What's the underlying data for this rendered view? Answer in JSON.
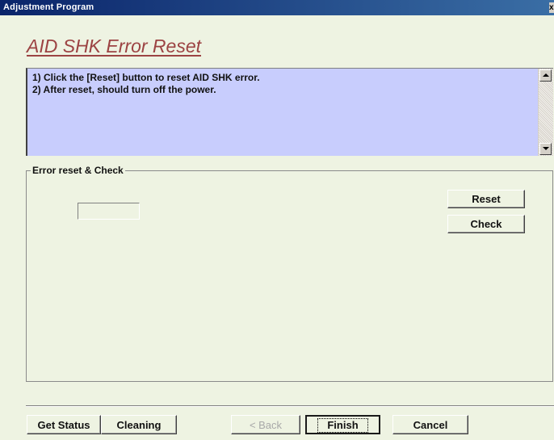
{
  "window": {
    "title": "Adjustment Program",
    "close_glyph": "x"
  },
  "page": {
    "title": "AID SHK Error Reset"
  },
  "instructions": {
    "lines": [
      "1) Click the [Reset] button to reset AID SHK error.",
      "2) After reset, should turn off the power."
    ]
  },
  "group": {
    "label": "Error reset & Check",
    "result_value": "",
    "reset_label": "Reset",
    "check_label": "Check"
  },
  "footer": {
    "get_status_label": "Get Status",
    "cleaning_label": "Cleaning",
    "back_label": "< Back",
    "finish_label": "Finish",
    "cancel_label": "Cancel"
  },
  "colors": {
    "window_bg": "#eef3e2",
    "title_text": "#9c4343",
    "instruction_bg": "#c8cdfd"
  }
}
